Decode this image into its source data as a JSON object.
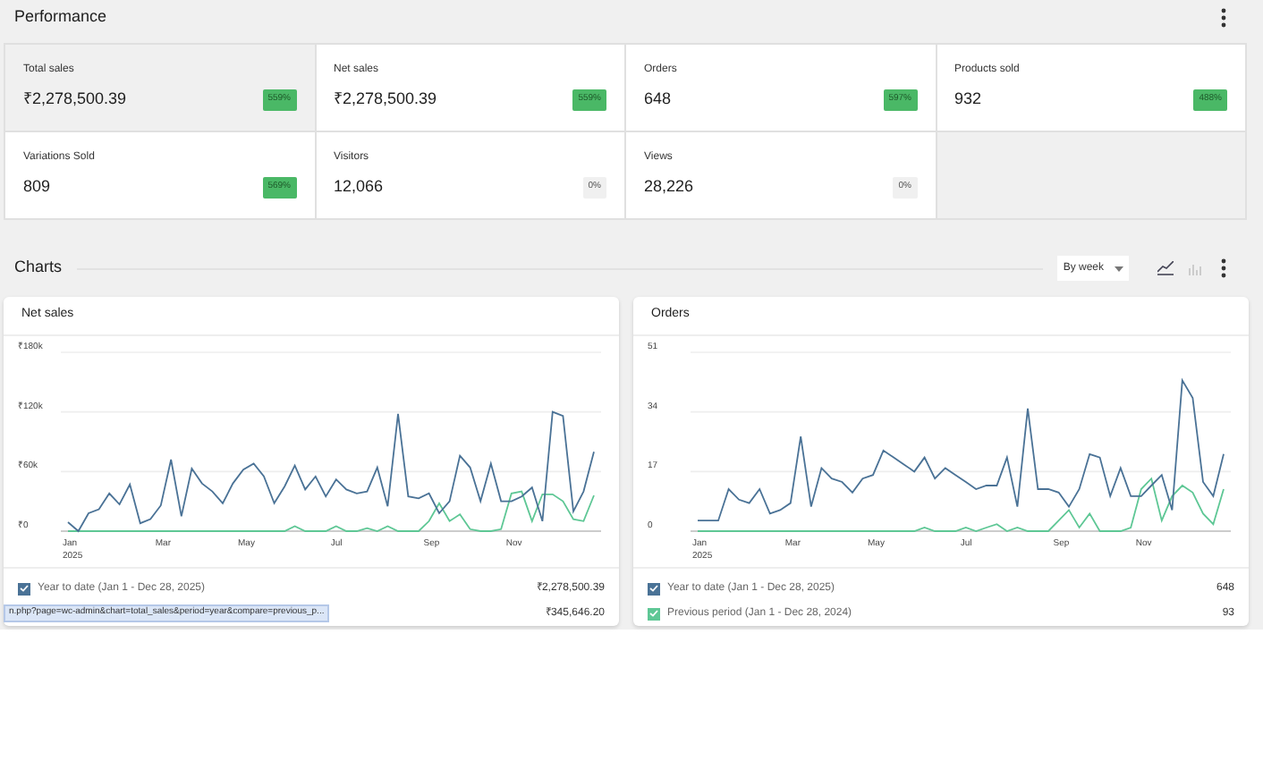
{
  "performance": {
    "title": "Performance",
    "metrics": [
      {
        "label": "Total sales",
        "value": "₹2,278,500.39",
        "delta": "559%",
        "positive": true,
        "selected": true
      },
      {
        "label": "Net sales",
        "value": "₹2,278,500.39",
        "delta": "559%",
        "positive": true,
        "selected": false
      },
      {
        "label": "Orders",
        "value": "648",
        "delta": "597%",
        "positive": true,
        "selected": false
      },
      {
        "label": "Products sold",
        "value": "932",
        "delta": "488%",
        "positive": true,
        "selected": false
      },
      {
        "label": "Variations Sold",
        "value": "809",
        "delta": "569%",
        "positive": true,
        "selected": false
      },
      {
        "label": "Visitors",
        "value": "12,066",
        "delta": "0%",
        "positive": false,
        "selected": false
      },
      {
        "label": "Views",
        "value": "28,226",
        "delta": "0%",
        "positive": false,
        "selected": false
      }
    ]
  },
  "charts_section": {
    "title": "Charts",
    "interval": "By week",
    "charts": [
      {
        "title": "Net sales",
        "year_label": "2025",
        "chart_data": {
          "type": "line",
          "categories": [
            "Jan",
            null,
            null,
            null,
            null,
            null,
            null,
            null,
            null,
            "Mar",
            null,
            null,
            null,
            null,
            null,
            null,
            null,
            "May",
            null,
            null,
            null,
            null,
            null,
            null,
            null,
            null,
            "Jul",
            null,
            null,
            null,
            null,
            null,
            null,
            null,
            null,
            "Sep",
            null,
            null,
            null,
            null,
            null,
            null,
            null,
            "Nov",
            null,
            null,
            null,
            null,
            null,
            null,
            null,
            null
          ],
          "ylim": [
            0,
            180
          ],
          "yticks": [
            {
              "value": 0,
              "label": "₹0"
            },
            {
              "value": 60,
              "label": "₹60k"
            },
            {
              "value": 120,
              "label": "₹120k"
            },
            {
              "value": 180,
              "label": "₹180k"
            }
          ],
          "series": [
            {
              "color": "#4a7296",
              "values": [
                9,
                0,
                18,
                22,
                38,
                27,
                47,
                8,
                12,
                26,
                72,
                15,
                63,
                48,
                40,
                28,
                48,
                62,
                68,
                55,
                28,
                45,
                66,
                42,
                55,
                35,
                52,
                42,
                38,
                40,
                64,
                25,
                118,
                35,
                33,
                38,
                18,
                30,
                76,
                64,
                30,
                68,
                30,
                30,
                35,
                44,
                10,
                120,
                116,
                20,
                40,
                80
              ]
            },
            {
              "color": "#5ec795",
              "values": [
                0,
                0,
                0,
                0,
                0,
                0,
                0,
                0,
                0,
                0,
                0,
                0,
                0,
                0,
                0,
                0,
                0,
                0,
                0,
                0,
                0,
                0,
                5,
                0,
                0,
                0,
                5,
                0,
                0,
                3,
                0,
                5,
                0,
                0,
                0,
                10,
                28,
                10,
                17,
                2,
                0,
                0,
                2,
                38,
                40,
                10,
                37,
                37,
                30,
                12,
                10,
                36
              ]
            }
          ]
        },
        "legend": [
          {
            "label": "Year to date (Jan 1 - Dec 28, 2025)",
            "value": "₹2,278,500.39",
            "checked": true,
            "color": "#4a7296"
          },
          {
            "value": "₹345,646.20"
          }
        ],
        "status_url": "n.php?page=wc-admin&chart=total_sales&period=year&compare=previous_p..."
      },
      {
        "title": "Orders",
        "year_label": "2025",
        "chart_data": {
          "type": "line",
          "categories": [
            "Jan",
            null,
            null,
            null,
            null,
            null,
            null,
            null,
            null,
            "Mar",
            null,
            null,
            null,
            null,
            null,
            null,
            null,
            "May",
            null,
            null,
            null,
            null,
            null,
            null,
            null,
            null,
            "Jul",
            null,
            null,
            null,
            null,
            null,
            null,
            null,
            null,
            "Sep",
            null,
            null,
            null,
            null,
            null,
            null,
            null,
            "Nov",
            null,
            null,
            null,
            null,
            null,
            null,
            null,
            null
          ],
          "ylim": [
            0,
            51
          ],
          "yticks": [
            0,
            17,
            34,
            51
          ],
          "series": [
            {
              "color": "#4a7296",
              "values": [
                3,
                3,
                3,
                12,
                9,
                8,
                12,
                5,
                6,
                8,
                27,
                7,
                18,
                15,
                14,
                11,
                15,
                16,
                23,
                21,
                19,
                17,
                21,
                15,
                18,
                16,
                14,
                12,
                13,
                13,
                21,
                7,
                35,
                12,
                12,
                11,
                7,
                12,
                22,
                21,
                10,
                18,
                10,
                10,
                13,
                16,
                6,
                43,
                38,
                14,
                10,
                22
              ]
            },
            {
              "color": "#5ec795",
              "values": [
                0,
                0,
                0,
                0,
                0,
                0,
                0,
                0,
                0,
                0,
                0,
                0,
                0,
                0,
                0,
                0,
                0,
                0,
                0,
                0,
                0,
                0,
                1,
                0,
                0,
                0,
                1,
                0,
                1,
                2,
                0,
                1,
                0,
                0,
                0,
                3,
                6,
                1,
                5,
                0,
                0,
                0,
                1,
                12,
                15,
                3,
                10,
                13,
                11,
                5,
                2,
                12
              ]
            }
          ]
        },
        "legend": [
          {
            "label": "Year to date (Jan 1 - Dec 28, 2025)",
            "value": "648",
            "checked": true,
            "color": "#4a7296"
          },
          {
            "label": "Previous period (Jan 1 - Dec 28, 2024)",
            "value": "93",
            "checked": true,
            "color": "#5ec795"
          }
        ]
      }
    ]
  }
}
